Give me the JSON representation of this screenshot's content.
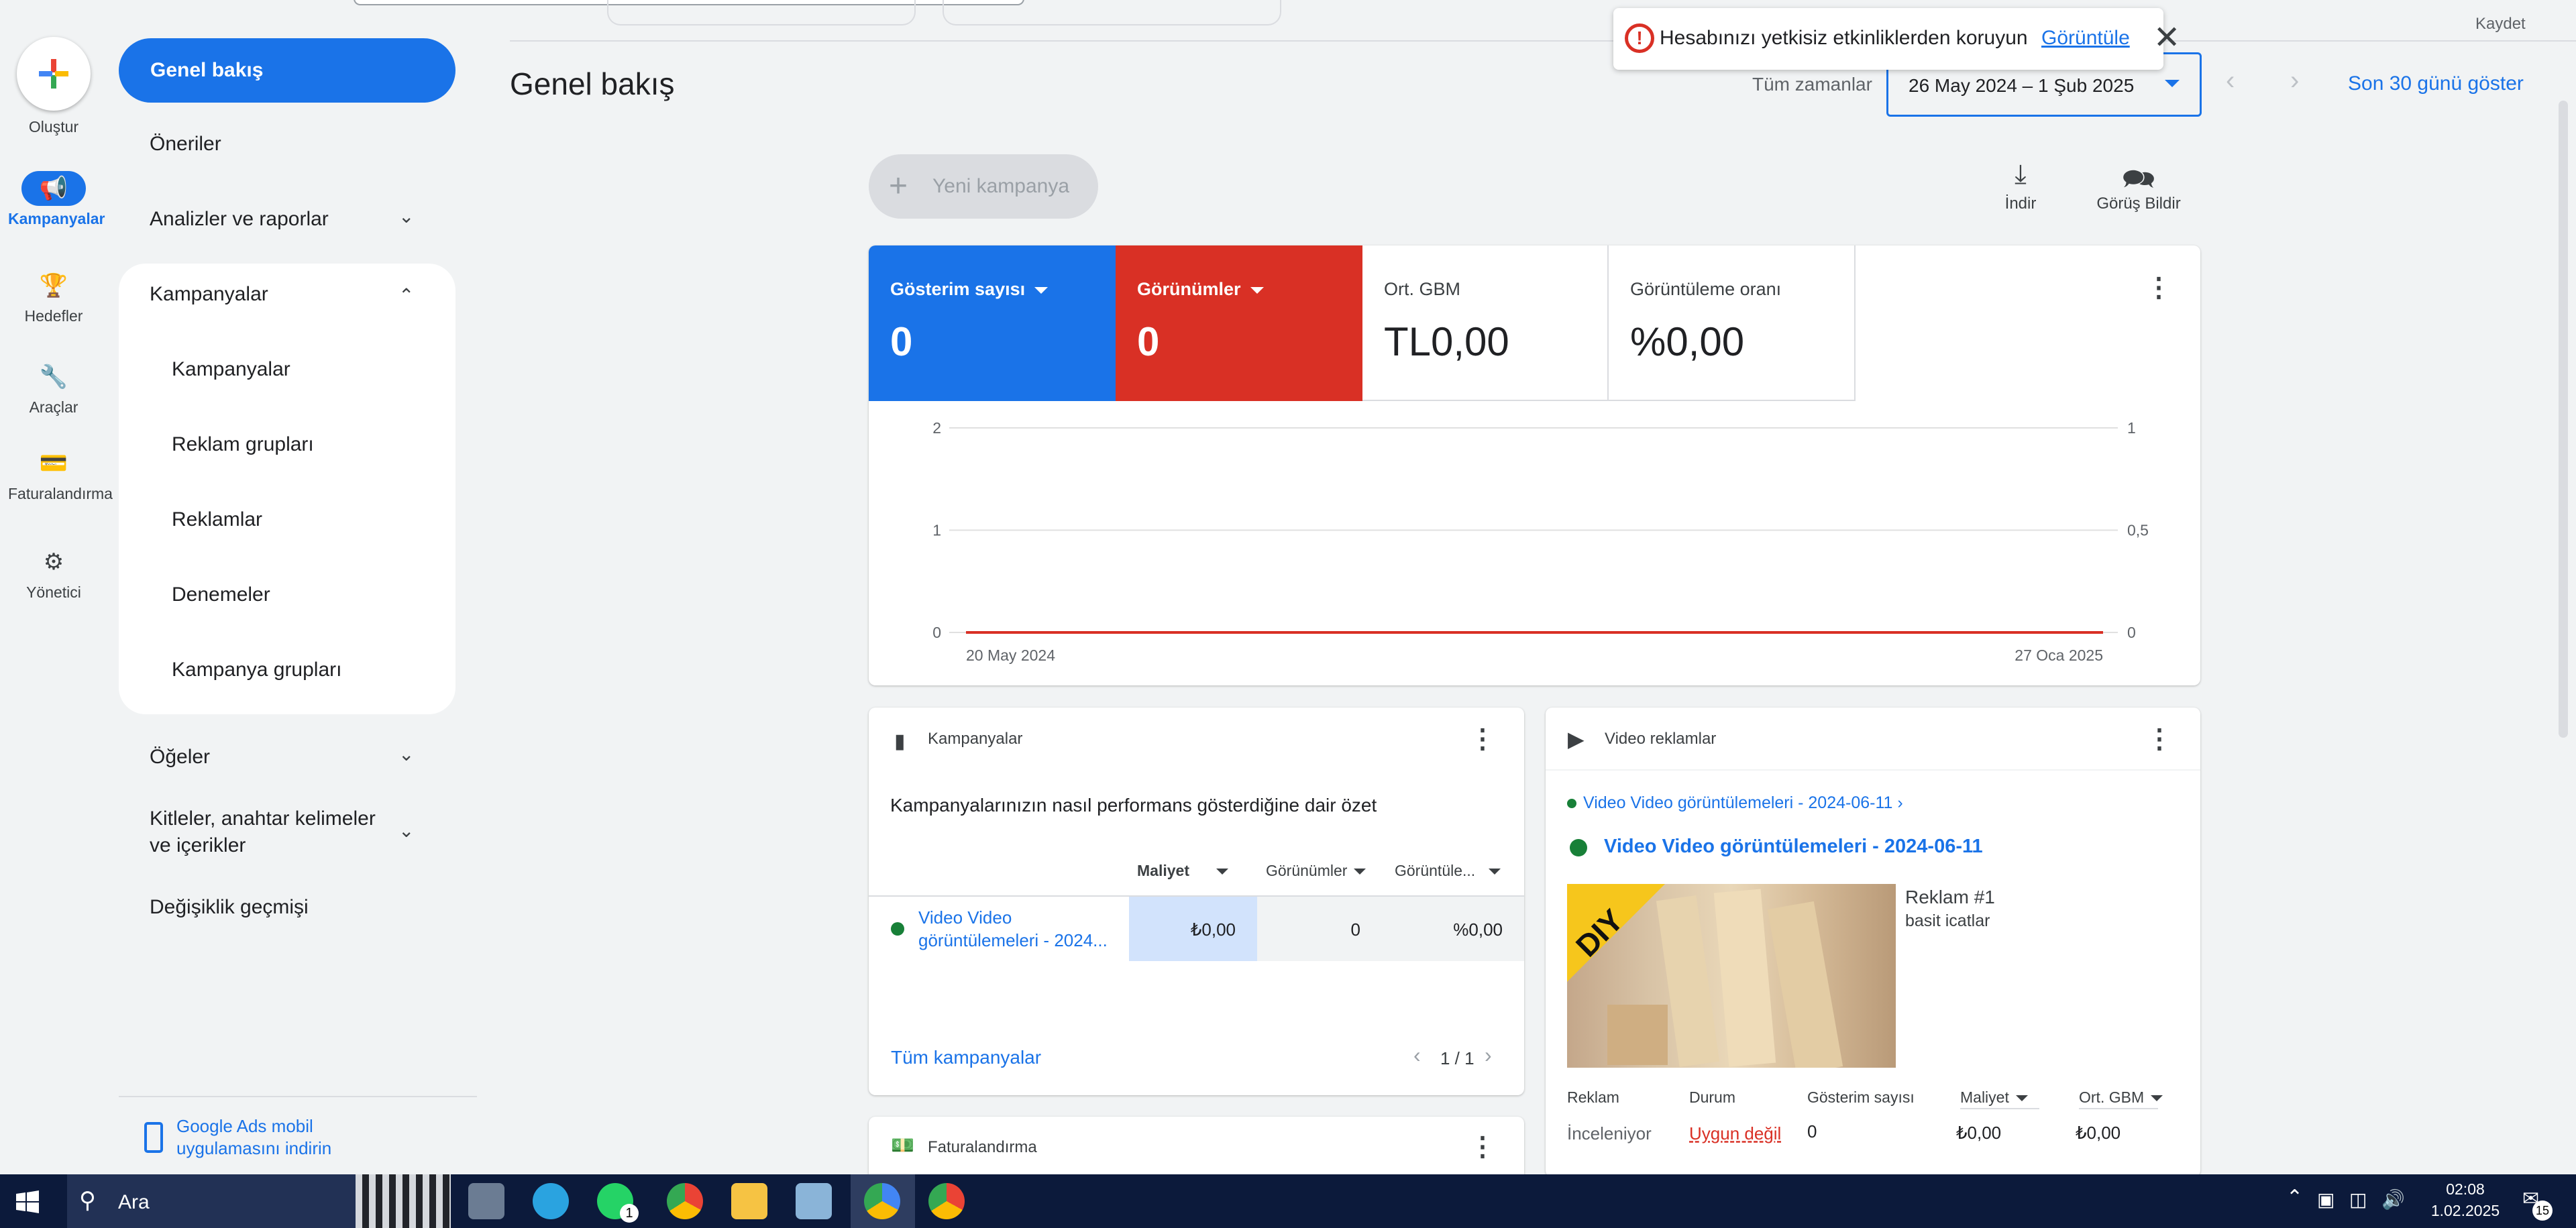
{
  "header": {
    "kaydet": "Kaydet",
    "page_title": "Genel bakış",
    "range_label": "Tüm zamanlar",
    "date_range": "26 May 2024 – 1 Şub 2025",
    "show_30": "Son 30 günü göster"
  },
  "toast": {
    "text": "Hesabınızı yetkisiz etkinliklerden koruyun",
    "link": "Görüntüle"
  },
  "rail": {
    "create": "Oluştur",
    "campaigns": "Kampanyalar",
    "goals": "Hedefler",
    "tools": "Araçlar",
    "billing": "Faturalandırma",
    "admin": "Yönetici"
  },
  "sidenav": {
    "overview": "Genel bakış",
    "recommendations": "Öneriler",
    "insights": "Analizler ve raporlar",
    "campaigns": "Kampanyalar",
    "sub": [
      "Kampanyalar",
      "Reklam grupları",
      "Reklamlar",
      "Denemeler",
      "Kampanya grupları"
    ],
    "assets": "Öğeler",
    "audiences": "Kitleler, anahtar kelimeler ve içerikler",
    "history": "Değişiklik geçmişi",
    "mobile_app": "Google Ads mobil uygulamasını indirin"
  },
  "toolbar": {
    "new_campaign": "Yeni kampanya",
    "download": "İndir",
    "feedback": "Görüş Bildir"
  },
  "metrics": [
    {
      "label": "Gösterim sayısı",
      "value": "0"
    },
    {
      "label": "Görünümler",
      "value": "0"
    },
    {
      "label": "Ort. GBM",
      "value": "TL0,00"
    },
    {
      "label": "Görüntüleme oranı",
      "value": "%0,00"
    }
  ],
  "chart_data": {
    "type": "line",
    "x": [
      "20 May 2024",
      "27 Oca 2025"
    ],
    "series": [
      {
        "values": [
          0,
          0
        ]
      }
    ],
    "y_left_ticks": [
      "2",
      "1",
      "0"
    ],
    "y_right_ticks": [
      "1",
      "0,5",
      "0"
    ],
    "ylim_left": [
      0,
      2
    ],
    "ylim_right": [
      0,
      1
    ],
    "grid": true
  },
  "campaigns_card": {
    "title": "Kampanyalar",
    "summary": "Kampanyalarınızın nasıl performans gösterdiğine dair özet",
    "columns": [
      "Maliyet",
      "Görünümler",
      "Görüntüle..."
    ],
    "row": {
      "name": "Video Video görüntülemeleri - 2024...",
      "cost": "₺0,00",
      "views": "0",
      "rate": "%0,00"
    },
    "all_link": "Tüm kampanyalar",
    "pagination": "1 / 1"
  },
  "billing_card": {
    "title": "Faturalandırma"
  },
  "video_card": {
    "title": "Video reklamlar",
    "breadcrumb": "Video Video görüntülemeleri - 2024-06-11 ›",
    "campaign_name": "Video Video görüntülemeleri - 2024-06-11",
    "ad_name": "Reklam #1",
    "ad_desc": "basit icatlar",
    "thumb_text": "DIY",
    "columns": [
      "Reklam",
      "Durum",
      "Gösterim sayısı",
      "Maliyet",
      "Ort. GBM"
    ],
    "row": {
      "ad": "İnceleniyor",
      "status": "Uygun değil",
      "impressions": "0",
      "cost": "₺0,00",
      "cpv": "₺0,00"
    }
  },
  "taskbar": {
    "search": "Ara",
    "time": "02:08",
    "date": "1.02.2025",
    "notif_count": "15",
    "whatsapp_badge": "1"
  },
  "colors": {
    "accent": "#1a73e8",
    "red": "#d93025",
    "green": "#188038"
  }
}
